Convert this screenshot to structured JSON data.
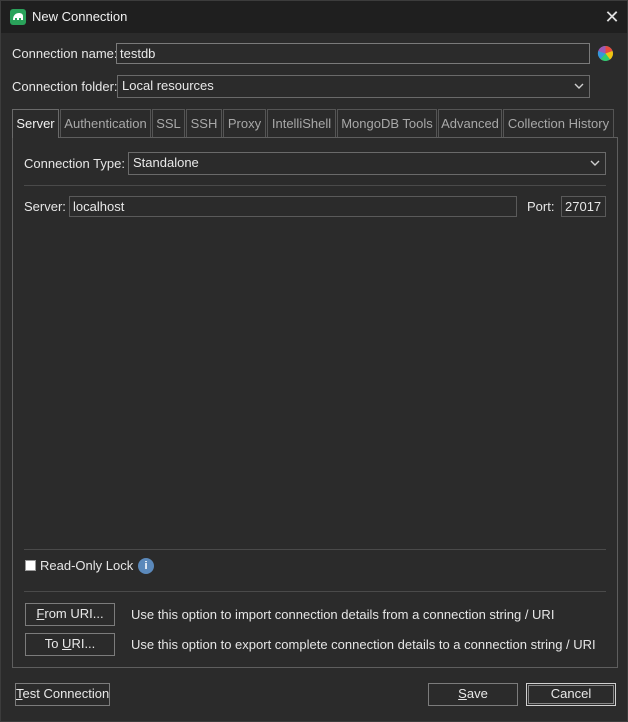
{
  "window": {
    "title": "New Connection",
    "close_glyph": "✕"
  },
  "form": {
    "connection_name_label": "Connection name:",
    "connection_name_value": "testdb",
    "connection_folder_label": "Connection folder:",
    "connection_folder_value": "Local resources"
  },
  "tabs": [
    {
      "label": "Server"
    },
    {
      "label": "Authentication"
    },
    {
      "label": "SSL"
    },
    {
      "label": "SSH"
    },
    {
      "label": "Proxy"
    },
    {
      "label": "IntelliShell"
    },
    {
      "label": "MongoDB Tools"
    },
    {
      "label": "Advanced"
    },
    {
      "label": "Collection History"
    }
  ],
  "server_tab": {
    "connection_type_label": "Connection Type:",
    "connection_type_value": "Standalone",
    "server_label": "Server:",
    "server_value": "localhost",
    "port_label": "Port:",
    "port_value": "27017"
  },
  "readonly": {
    "label": "Read-Only Lock",
    "checked": false,
    "info_glyph": "i"
  },
  "uri": {
    "from_pre": "",
    "from_key": "F",
    "from_post": "rom URI...",
    "from_desc": "Use this option to import connection details from a connection string / URI",
    "to_pre": "To ",
    "to_key": "U",
    "to_post": "RI...",
    "to_desc": "Use this option to export complete connection details to a connection string / URI"
  },
  "footer": {
    "test_key": "T",
    "test_post": "est Connection",
    "save_key": "S",
    "save_post": "ave",
    "cancel_label": "Cancel"
  },
  "colors": {
    "background": "#2b2b2b",
    "titlebar": "#1f1f1f",
    "app_icon": "#2aa25a",
    "info_icon": "#5b89bb"
  },
  "icons": {
    "app": "studio3t-app-icon",
    "close": "close-icon",
    "color_picker": "color-wheel-icon",
    "dropdown": "chevron-down-icon",
    "info": "info-icon"
  }
}
